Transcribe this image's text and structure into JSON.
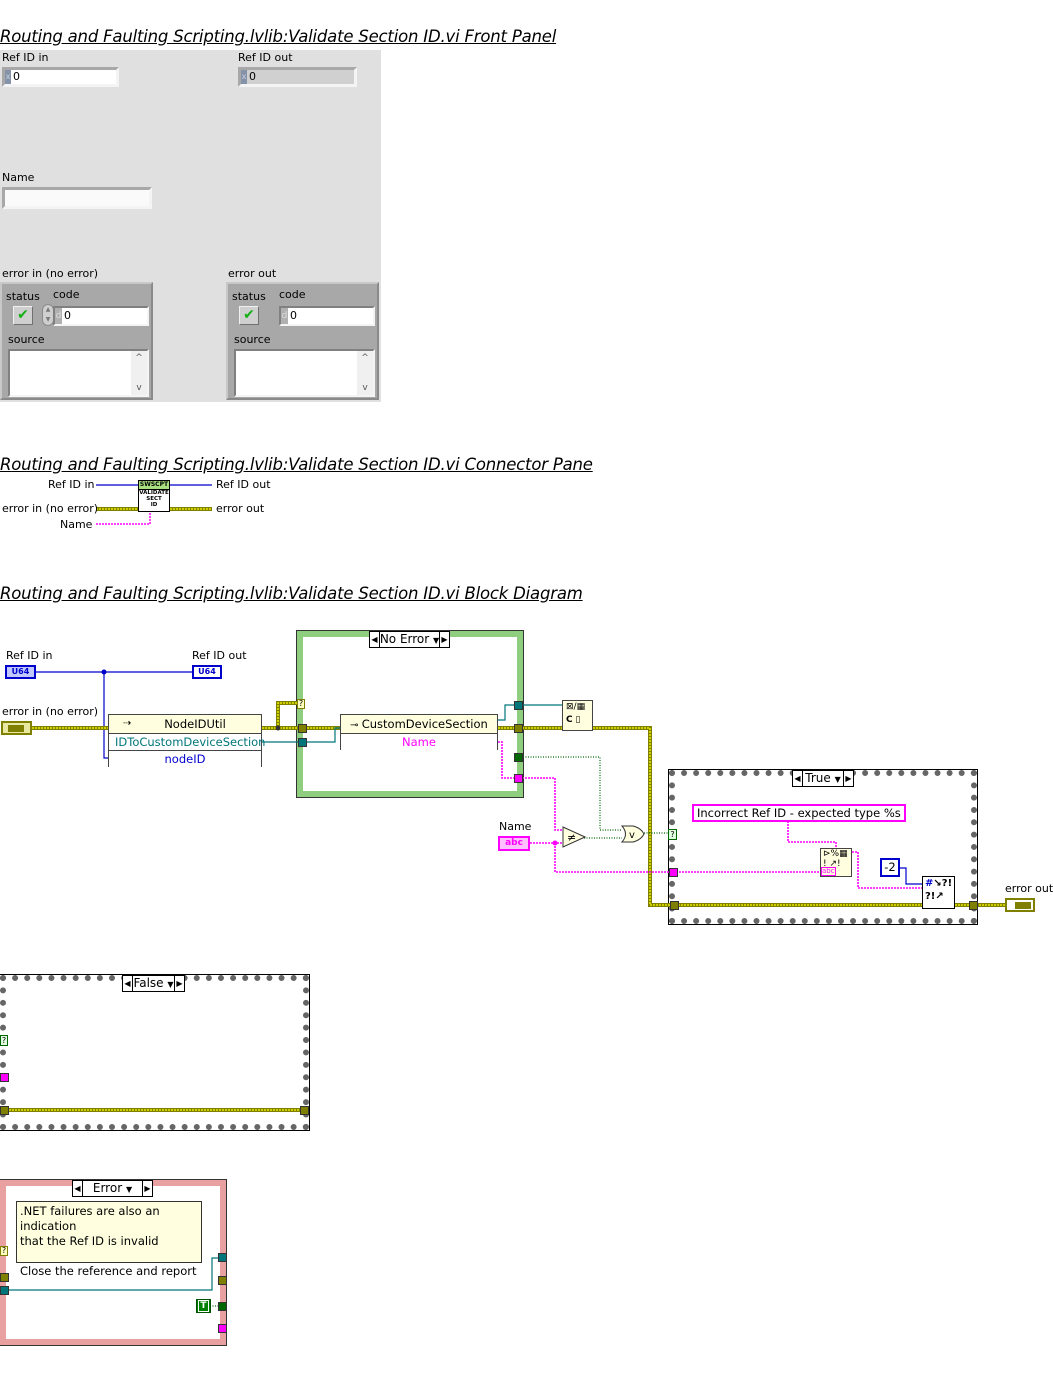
{
  "sections": {
    "front_panel_title": "Routing and Faulting Scripting.lvlib:Validate Section ID.vi Front Panel",
    "connector_pane_title": "Routing and Faulting Scripting.lvlib:Validate Section ID.vi Connector Pane",
    "block_diagram_title": "Routing and Faulting Scripting.lvlib:Validate Section ID.vi Block Diagram"
  },
  "front_panel": {
    "ref_id_in": {
      "label": "Ref ID in",
      "radix": "x",
      "value": "0"
    },
    "ref_id_out": {
      "label": "Ref ID out",
      "radix": "x",
      "value": "0"
    },
    "name": {
      "label": "Name",
      "value": ""
    },
    "error_in": {
      "label": "error in (no error)",
      "status_label": "status",
      "status_icon": "checkmark-icon",
      "code_label": "code",
      "code_radix": "d",
      "code_value": "0",
      "source_label": "source",
      "source_value": ""
    },
    "error_out": {
      "label": "error out",
      "status_label": "status",
      "status_icon": "checkmark-icon",
      "code_label": "code",
      "code_radix": "d",
      "code_value": "0",
      "source_label": "source",
      "source_value": ""
    },
    "scroll_up": "^",
    "scroll_down": "v"
  },
  "connector_pane": {
    "inputs": [
      "Ref ID in",
      "error in (no error)",
      "Name"
    ],
    "outputs": [
      "Ref ID out",
      "error out"
    ],
    "icon_banner": "SWSCPT",
    "icon_text": [
      "VALIDATE",
      "SECT",
      "ID"
    ]
  },
  "block_diagram": {
    "ref_id_in_label": "Ref ID in",
    "ref_id_out_label": "Ref ID out",
    "error_in_label": "error in (no error)",
    "error_out_label": "error out",
    "name_label": "Name",
    "u64": "U64",
    "abc": "abc",
    "node_util": {
      "class": "NodeIDUtil",
      "method": "IDToCustomDeviceSection",
      "param": "nodeID"
    },
    "property_node": {
      "class": "CustomDeviceSection",
      "property": "Name"
    },
    "case_no_error": "No Error",
    "case_true": "True",
    "case_false": "False",
    "case_error": "Error",
    "format_string": "Incorrect Ref ID - expected type %s",
    "error_code_constant": "-2",
    "true_constant": "T",
    "selector_q": "?",
    "comment": ".NET failures are also an indication\nthat the Ref ID is invalid\n\nClose the reference and report",
    "colors": {
      "error_wire": "#7f7f00",
      "error_wire_dash": "#ffff00",
      "refnum_wire": "#0000cc",
      "dotnet_wire": "#00767a",
      "string_wire": "#ff00ff",
      "bool_wire": "#006600",
      "case_no_error_border": "#8fce7f",
      "case_error_border": "#e08080"
    }
  }
}
